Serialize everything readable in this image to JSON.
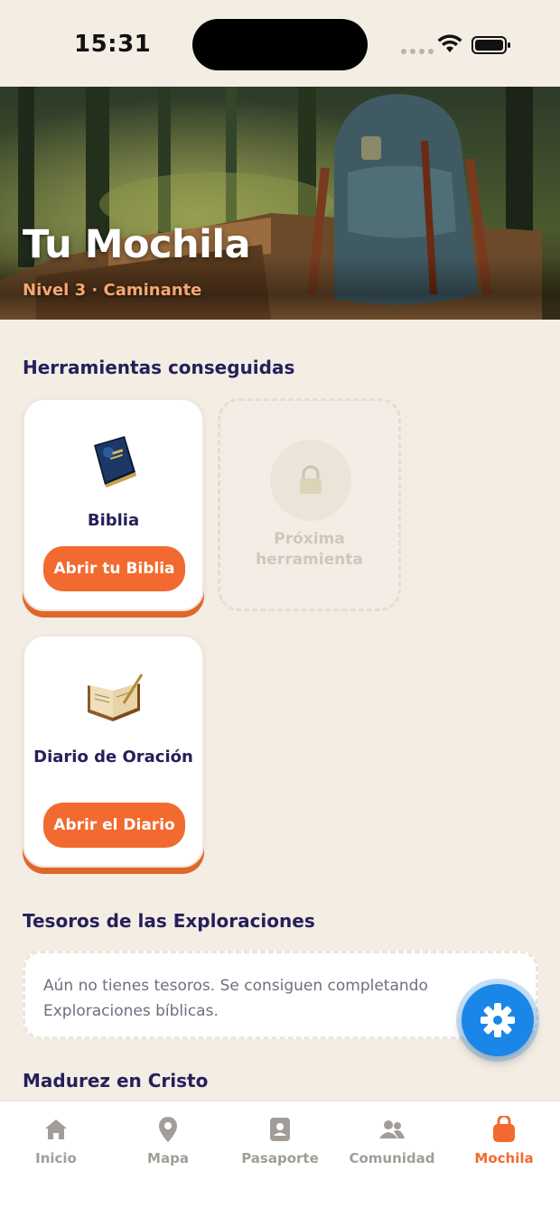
{
  "status": {
    "time": "15:31"
  },
  "hero": {
    "title": "Tu Mochila",
    "subtitle": "Nivel 3 · Caminante"
  },
  "tools_section": {
    "title": "Herramientas conseguidas",
    "cards": [
      {
        "name": "Biblia",
        "button": "Abrir tu Biblia",
        "icon": "bible-book-icon"
      },
      {
        "name": "Diario de Oración",
        "button": "Abrir el Diario",
        "icon": "journal-book-icon"
      }
    ],
    "locked": {
      "label": "Próxima herramienta",
      "icon": "padlock-icon"
    }
  },
  "treasures": {
    "title": "Tesoros de las Exploraciones",
    "empty_text": "Aún no tienes tesoros. Se consiguen completando Exploraciones bíblicas."
  },
  "maturity": {
    "title": "Madurez en Cristo"
  },
  "fab": {
    "icon": "gear-icon"
  },
  "tabbar": {
    "items": [
      {
        "label": "Inicio",
        "icon": "home-icon"
      },
      {
        "label": "Mapa",
        "icon": "map-pin-icon"
      },
      {
        "label": "Pasaporte",
        "icon": "passport-icon"
      },
      {
        "label": "Comunidad",
        "icon": "people-icon"
      },
      {
        "label": "Mochila",
        "icon": "backpack-icon"
      }
    ],
    "active": "Mochila"
  },
  "colors": {
    "accent": "#f26a30",
    "navy": "#24205a",
    "background": "#f4ede4",
    "fab": "#1a86e8"
  }
}
